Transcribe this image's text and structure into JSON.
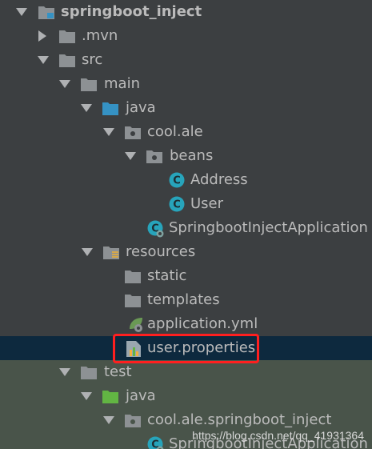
{
  "colors": {
    "background": "#3c3f41",
    "selected_row": "#0d293e",
    "test_rows": "#49544a",
    "text": "#bbbbbb",
    "highlight_box": "#ff1f1f",
    "folder_gray": "#8d9194",
    "source_folder_blue": "#3592c4",
    "test_folder_green": "#62b543",
    "class_icon_teal": "#27a4bb"
  },
  "tree": {
    "items": [
      {
        "label": "springboot_inject",
        "icon": "project-folder-icon",
        "expanded": true
      },
      {
        "label": ".mvn",
        "icon": "folder-icon",
        "expanded": false
      },
      {
        "label": "src",
        "icon": "folder-icon",
        "expanded": true
      },
      {
        "label": "main",
        "icon": "folder-icon",
        "expanded": true
      },
      {
        "label": "java",
        "icon": "source-folder-icon",
        "expanded": true
      },
      {
        "label": "cool.ale",
        "icon": "package-icon",
        "expanded": true
      },
      {
        "label": "beans",
        "icon": "package-icon",
        "expanded": true
      },
      {
        "label": "Address",
        "icon": "class-icon"
      },
      {
        "label": "User",
        "icon": "class-icon"
      },
      {
        "label": "SpringbootInjectApplication",
        "icon": "spring-boot-class-icon"
      },
      {
        "label": "resources",
        "icon": "resources-folder-icon",
        "expanded": true
      },
      {
        "label": "static",
        "icon": "folder-icon"
      },
      {
        "label": "templates",
        "icon": "folder-icon"
      },
      {
        "label": "application.yml",
        "icon": "spring-config-icon"
      },
      {
        "label": "user.properties",
        "icon": "properties-file-icon",
        "selected": true
      },
      {
        "label": "test",
        "icon": "folder-icon",
        "expanded": true
      },
      {
        "label": "java",
        "icon": "test-source-folder-icon",
        "expanded": true
      },
      {
        "label": "cool.ale.springboot_inject",
        "icon": "package-icon",
        "expanded": true
      },
      {
        "label": "SpringbootInjectApplication",
        "icon": "spring-boot-class-icon"
      }
    ]
  },
  "watermark": "https://blog.csdn.net/qq_41931364"
}
